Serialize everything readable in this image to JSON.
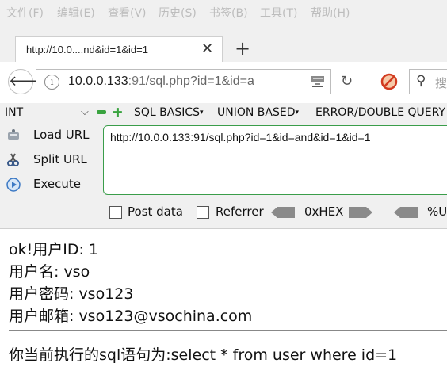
{
  "menubar": {
    "items": [
      "文件(F)",
      "编辑(E)",
      "查看(V)",
      "历史(S)",
      "书签(B)",
      "工具(T)",
      "帮助(H)"
    ]
  },
  "tab": {
    "title": "http://10.0....nd&id=1&id=1"
  },
  "urlbar": {
    "host": "10.0.0.133",
    "port": ":91",
    "path": "/sql.php?id=1&id=a"
  },
  "search": {
    "placeholder": "搜"
  },
  "hackbar": {
    "type_select": "INT",
    "menus": [
      "SQL BASICS",
      "UNION BASED",
      "ERROR/DOUBLE QUERY"
    ],
    "buttons": {
      "load_url": "Load URL",
      "split_url": "Split URL",
      "execute": "Execute"
    },
    "url_value": "http://10.0.0.133:91/sql.php?id=1&id=and&id=1&id=1",
    "post_data_label": "Post data",
    "referrer_label": "Referrer",
    "hex_label": "0xHEX",
    "url_encode_label": "%U"
  },
  "page": {
    "line1": "ok!用户ID: 1",
    "line2": "用户名: vso",
    "line3": "用户密码: vso123",
    "line4": "用户邮箱: vso123@vsochina.com",
    "sql_line": "你当前执行的sql语句为:select * from user where id=1"
  },
  "colors": {
    "accent_green": "#3a9d4a",
    "menu_text_disabled": "#bdbdbd"
  }
}
